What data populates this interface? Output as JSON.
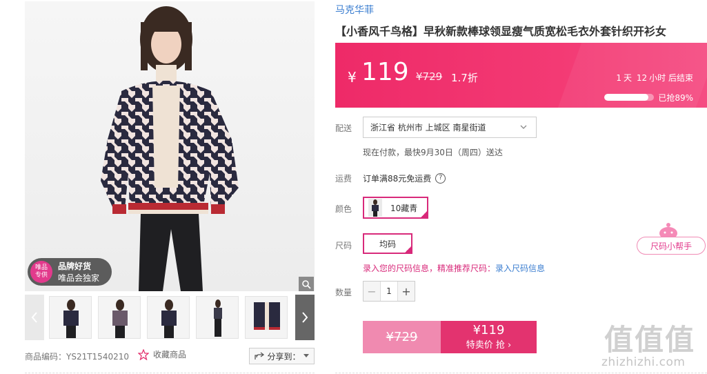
{
  "gallery": {
    "badge": {
      "logo_text": "唯品\n专供",
      "line1": "品牌好货",
      "line2": "唯品会独家"
    },
    "thumbnails": [
      {
        "name": "thumb-1"
      },
      {
        "name": "thumb-2"
      },
      {
        "name": "thumb-3"
      },
      {
        "name": "thumb-4"
      },
      {
        "name": "thumb-5"
      }
    ],
    "item_code": "商品编码：YS21T1540210",
    "favorite_label": "收藏商品",
    "share_label": "分享到："
  },
  "product": {
    "brand": "马克华菲",
    "title": "【小香风千鸟格】早秋新款棒球领显瘦气质宽松毛衣外套针织开衫女"
  },
  "price": {
    "currency": "¥",
    "current": "119",
    "original": "¥729",
    "discount": "1.7折",
    "countdown": {
      "days": "1",
      "day_unit": "天",
      "hours": "12",
      "hour_unit": "小时",
      "suffix": "后结束"
    },
    "sold_percent": 89,
    "sold_text": "已抢89%"
  },
  "delivery": {
    "label": "配送",
    "address": "浙江省 杭州市 上城区 南星街道",
    "eta": "现在付款，最快9月30日（周四）送达"
  },
  "shipping": {
    "label": "运费",
    "text": "订单满88元免运费"
  },
  "color": {
    "label": "颜色",
    "selected": "10藏青"
  },
  "size": {
    "label": "尺码",
    "selected": "均码",
    "tip_prefix": "录入您的尺码信息，精准推荐尺码：",
    "tip_link": "录入尺码信息",
    "helper_label": "尺码小帮手"
  },
  "quantity": {
    "label": "数量",
    "value": "1",
    "minus": "−",
    "plus": "+"
  },
  "buy": {
    "old_price": "¥729",
    "new_price": "¥119",
    "action": "特卖价 抢 ›"
  },
  "watermark": {
    "chars": "值值值",
    "url": "zhizhizhi.com"
  },
  "colors": {
    "accent": "#e3336f",
    "brand_link": "#3b7ed0",
    "price_bar": "#ee2a68"
  }
}
